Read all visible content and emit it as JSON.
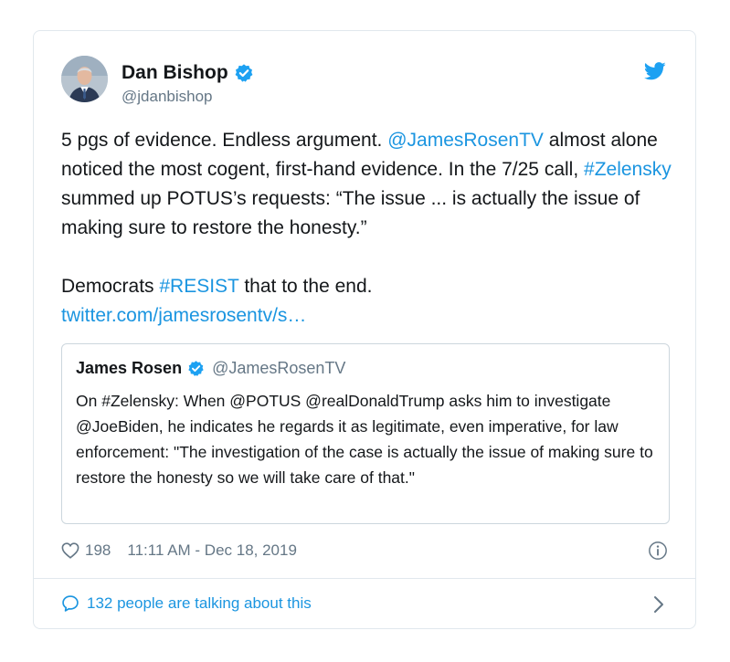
{
  "author": {
    "name": "Dan Bishop",
    "handle": "@jdanbishop"
  },
  "tweet": {
    "p1_a": "5 pgs of evidence. Endless argument. ",
    "p1_link1": "@JamesRosenTV",
    "p1_b": " almost alone noticed the most cogent, first-hand evidence. In the 7/25 call, ",
    "p1_link2": "#Zelensky",
    "p1_c": " summed up POTUS’s requests: “The issue ... is actually the issue of making sure to restore the honesty.”",
    "p2_a": "Democrats ",
    "p2_link": "#RESIST",
    "p2_b": " that to the end.",
    "url": "twitter.com/jamesrosentv/s…"
  },
  "quoted": {
    "name": "James Rosen",
    "handle": "@JamesRosenTV",
    "text": "On #Zelensky: When @POTUS @realDonaldTrump asks him to investigate @JoeBiden, he indicates he regards it as legitimate, even imperative, for law enforcement: \"The investigation of the case is actually the issue of making sure to restore the honesty so we will take care of that.\""
  },
  "meta": {
    "likes": "198",
    "timestamp": "11:11 AM - Dec 18, 2019"
  },
  "conversation": {
    "label": "132 people are talking about this"
  },
  "icons": {
    "verified": "verified-badge-icon",
    "bird": "twitter-bird-icon",
    "heart": "heart-icon",
    "info": "info-icon",
    "bubble": "speech-bubble-icon",
    "chevron": "chevron-right-icon"
  },
  "colors": {
    "link": "#1b95e0",
    "muted": "#657786",
    "border": "#e1e8ed"
  }
}
